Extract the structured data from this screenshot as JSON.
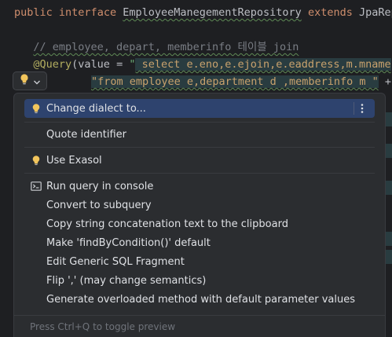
{
  "editor": {
    "line1": {
      "kw1": "public",
      "kw2": "interface",
      "name": "EmployeeManegementRepository",
      "kw3": "extends",
      "tail": "JpaRepo"
    },
    "line2": {
      "comment": "// employee, depart, memberinfo 테이블 join"
    },
    "line3": {
      "annotation": "@Query",
      "paren": "(value = ",
      "quote": "\"",
      "sql": " select e.eno,e.ejoin,e.eaddress,m.mname"
    },
    "line4": {
      "from": "\"from employee e,department d ,memberinfo m \"",
      "plus": " +"
    }
  },
  "quick_fix_button": {
    "icon": "lightbulb-icon",
    "chevron": "chevron-down-icon"
  },
  "popup": {
    "items": [
      {
        "label": "Change dialect to...",
        "icon": "lightbulb-icon",
        "selected": true
      },
      {
        "label": "Quote identifier",
        "icon": ""
      },
      {
        "label": "Use Exasol",
        "icon": "lightbulb-icon"
      },
      {
        "label": "Run query in console",
        "icon": "console-icon"
      },
      {
        "label": "Convert to subquery",
        "icon": ""
      },
      {
        "label": "Copy string concatenation text to the clipboard",
        "icon": ""
      },
      {
        "label": "Make 'findByCondition()' default",
        "icon": ""
      },
      {
        "label": "Edit Generic SQL Fragment",
        "icon": ""
      },
      {
        "label": "Flip ',' (may change semantics)",
        "icon": ""
      },
      {
        "label": "Generate overloaded method with default parameter values",
        "icon": ""
      }
    ],
    "more_icon": "more-vertical-icon",
    "footer": "Press Ctrl+Q to toggle preview"
  },
  "colors": {
    "accent_selected": "#2e436e",
    "bulb": "#f2c55c",
    "background": "#1e1f22",
    "popup_bg": "#2b2d30"
  }
}
